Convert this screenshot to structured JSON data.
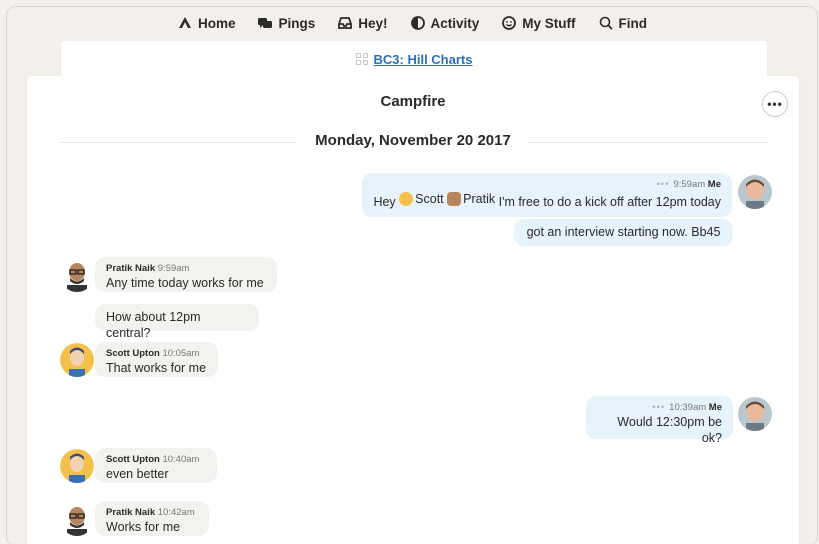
{
  "nav": {
    "home": "Home",
    "pings": "Pings",
    "hey": "Hey!",
    "activity": "Activity",
    "my_stuff": "My Stuff",
    "find": "Find"
  },
  "project": {
    "name": "BC3: Hill Charts"
  },
  "campfire": {
    "title": "Campfire",
    "menu_label": "•••",
    "date": "Monday, November 20 2017"
  },
  "messages": [
    {
      "time": "9:59am",
      "author": "Me",
      "text_prefix": "Hey",
      "mention1": "Scott",
      "mention2": "Pratik",
      "text_suffix": "I'm free to do a kick off after 12pm today"
    },
    {
      "text": "got an interview starting now. Bb45"
    },
    {
      "author": "Pratik Naik",
      "time": "9:59am",
      "text": "Any time today works for me"
    },
    {
      "text": "How about 12pm central?"
    },
    {
      "author": "Scott Upton",
      "time": "10:05am",
      "text": "That works for me"
    },
    {
      "time": "10:39am",
      "author": "Me",
      "text": "Would 12:30pm be ok?"
    },
    {
      "author": "Scott Upton",
      "time": "10:40am",
      "text": "even better"
    },
    {
      "author": "Pratik Naik",
      "time": "10:42am",
      "text": "Works for me"
    }
  ],
  "dots": "•••"
}
